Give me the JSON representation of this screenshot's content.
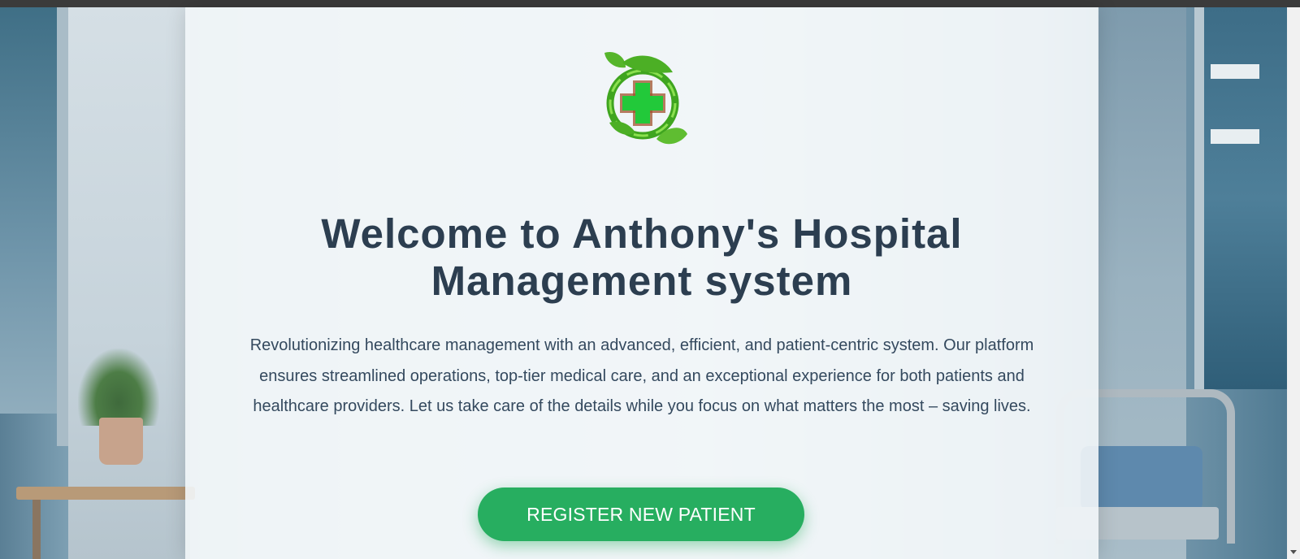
{
  "hero": {
    "title": "Welcome to Anthony's Hospital Management system",
    "description": "Revolutionizing healthcare management with an advanced, efficient, and patient-centric system. Our platform ensures streamlined operations, top-tier medical care, and an exceptional experience for both patients and healthcare providers. Let us take care of the details while you focus on what matters the most – saving lives.",
    "register_button_label": "REGISTER NEW PATIENT"
  },
  "logo": {
    "icon": "green-cross-leaf-icon"
  },
  "colors": {
    "primary_green": "#27ae60",
    "heading": "#2c3e50",
    "text": "#34495e",
    "logo_cross": "#22c93a",
    "logo_leaf": "#4caf25"
  }
}
